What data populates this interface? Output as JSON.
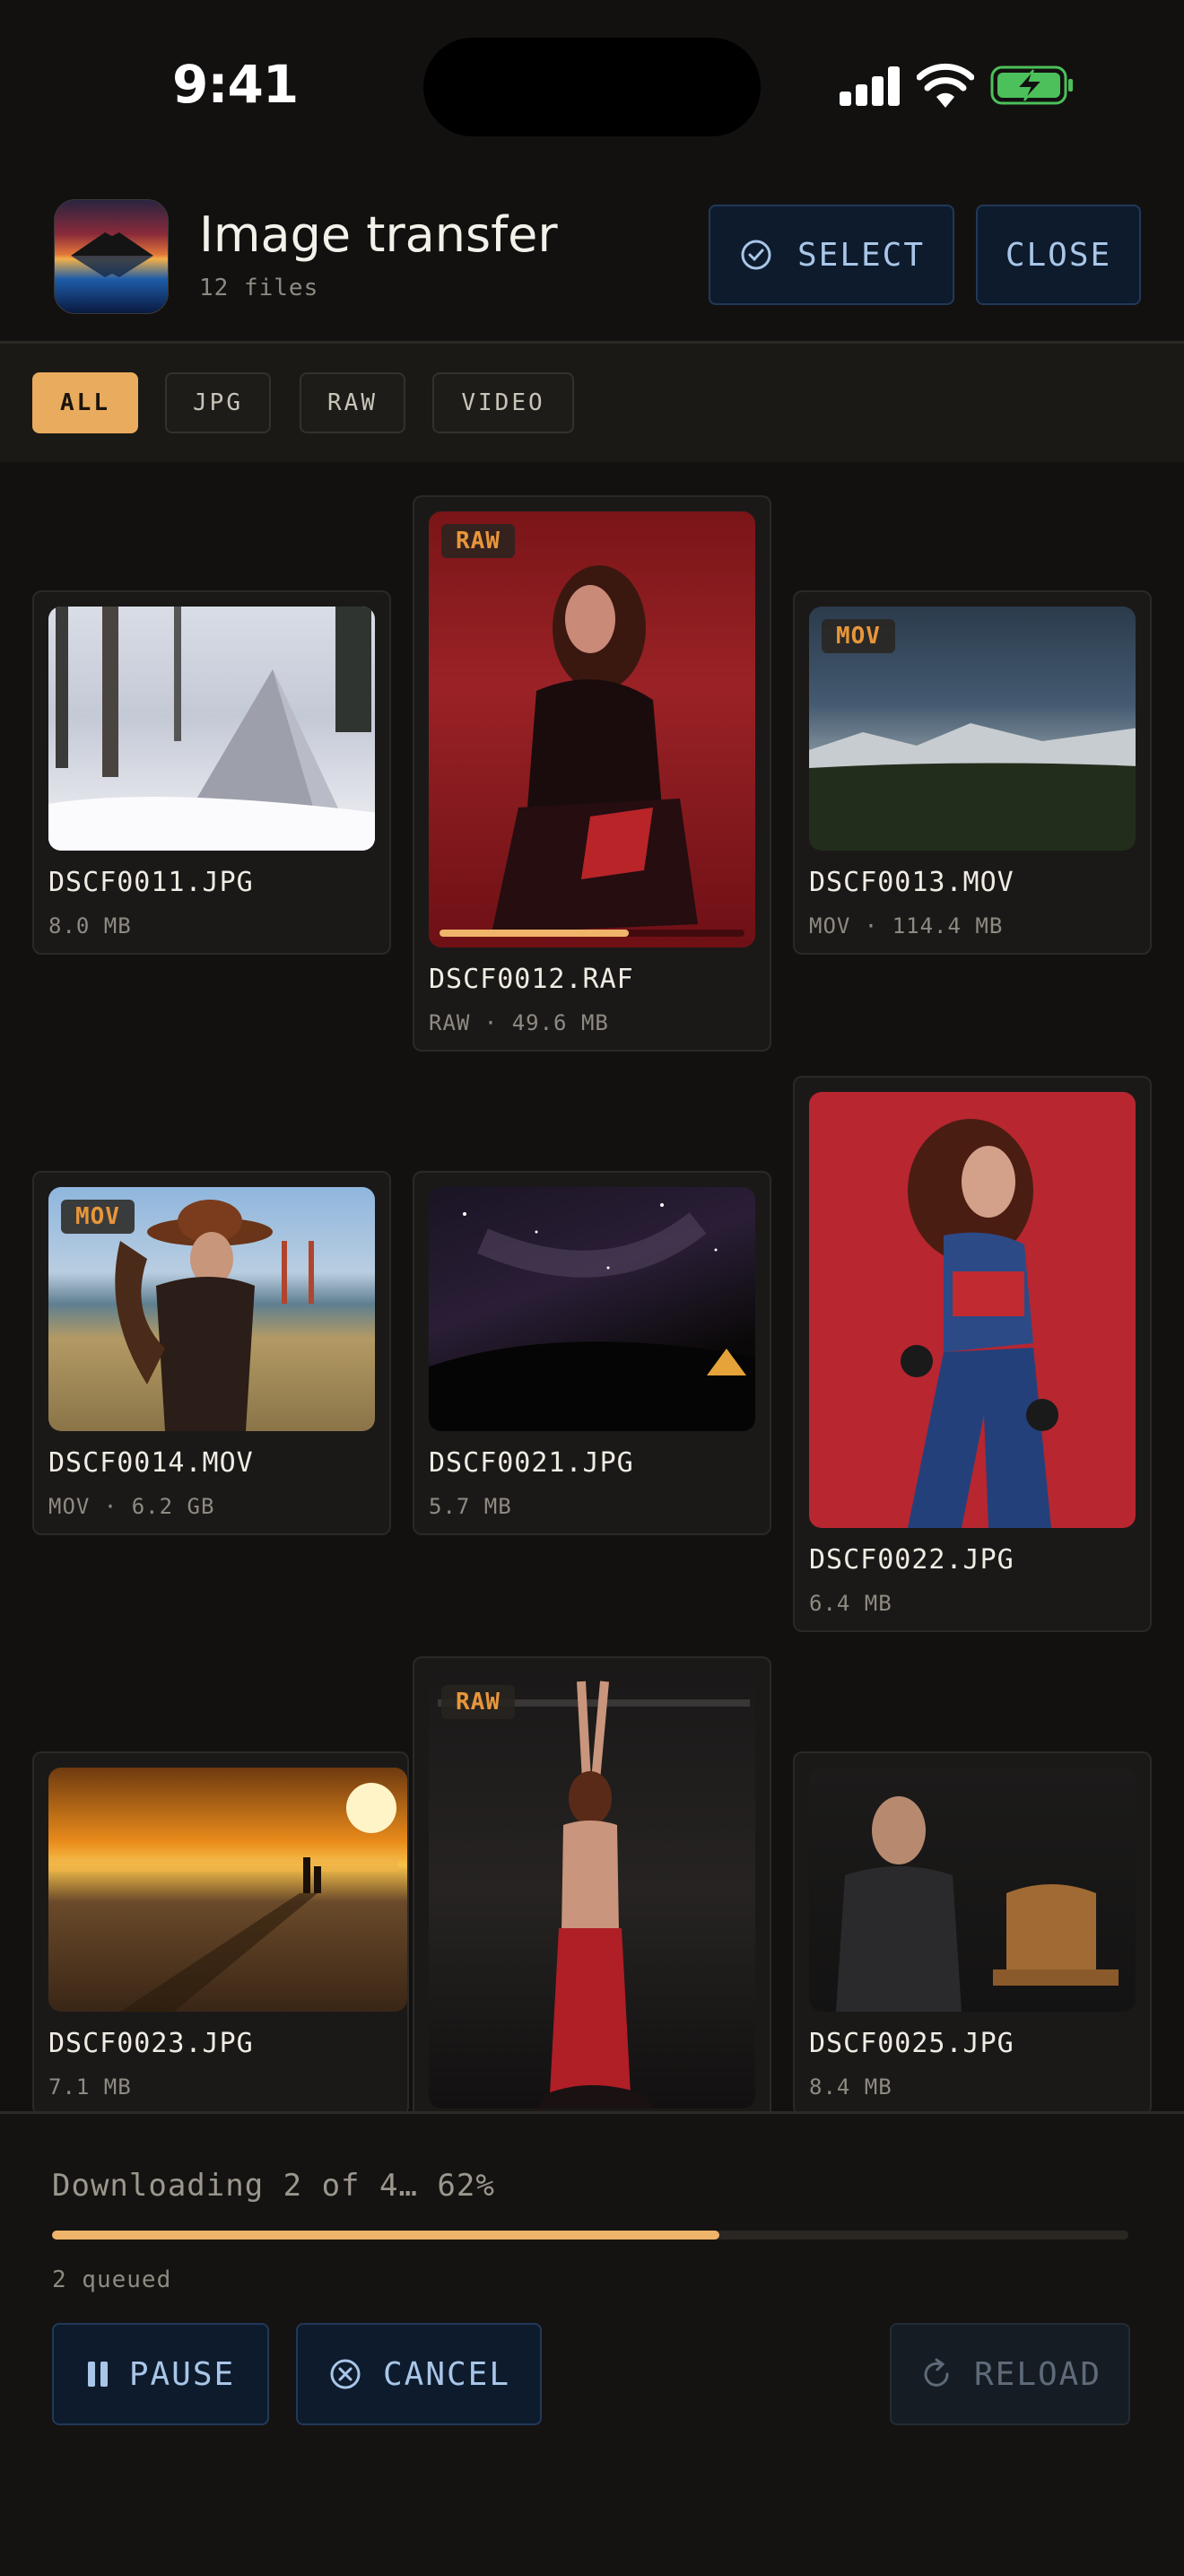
{
  "status": {
    "time": "9:41"
  },
  "header": {
    "title": "Image transfer",
    "subtitle": "12 files",
    "select_label": "SELECT",
    "close_label": "CLOSE"
  },
  "filters": [
    {
      "label": "ALL",
      "active": true
    },
    {
      "label": "JPG",
      "active": false
    },
    {
      "label": "RAW",
      "active": false
    },
    {
      "label": "VIDEO",
      "active": false
    }
  ],
  "files": [
    {
      "name": "DSCF0011.JPG",
      "meta": "8.0 MB",
      "badge": ""
    },
    {
      "name": "DSCF0012.RAF",
      "meta": "RAW · 49.6 MB",
      "badge": "RAW",
      "progress": 0.62
    },
    {
      "name": "DSCF0013.MOV",
      "meta": "MOV · 114.4 MB",
      "badge": "MOV"
    },
    {
      "name": "DSCF0014.MOV",
      "meta": "MOV · 6.2 GB",
      "badge": "MOV"
    },
    {
      "name": "DSCF0021.JPG",
      "meta": "5.7 MB",
      "badge": ""
    },
    {
      "name": "DSCF0022.JPG",
      "meta": "6.4 MB",
      "badge": ""
    },
    {
      "name": "DSCF0023.JPG",
      "meta": "7.1 MB",
      "badge": ""
    },
    {
      "name": "",
      "meta": "",
      "badge": "RAW"
    },
    {
      "name": "DSCF0025.JPG",
      "meta": "8.4 MB",
      "badge": ""
    }
  ],
  "transfer": {
    "status_text": "Downloading 2 of 4… 62%",
    "progress": 0.62,
    "queued_text": "2 queued",
    "pause_label": "PAUSE",
    "cancel_label": "CANCEL",
    "reload_label": "RELOAD"
  },
  "colors": {
    "accent": "#f0b46a",
    "button_bg": "#0d1b2d",
    "button_text": "#a9c6e8",
    "badge": "#e8963a"
  }
}
